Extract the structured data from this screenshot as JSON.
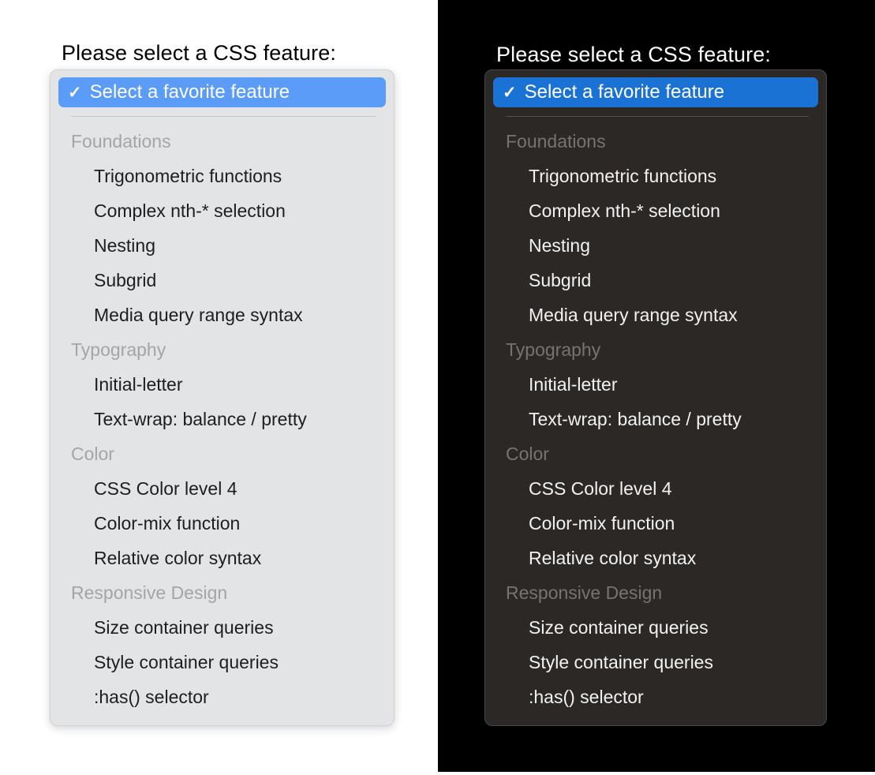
{
  "prompt": {
    "heading": "Please select a CSS feature:"
  },
  "dropdown": {
    "selected_option": {
      "label": "Select a favorite feature",
      "check_icon": "checkmark-icon",
      "check_glyph": "✓"
    },
    "groups": [
      {
        "label": "Foundations",
        "options": [
          "Trigonometric functions",
          "Complex nth-* selection",
          "Nesting",
          "Subgrid",
          "Media query range syntax"
        ]
      },
      {
        "label": "Typography",
        "options": [
          "Initial-letter",
          "Text-wrap: balance / pretty"
        ]
      },
      {
        "label": "Color",
        "options": [
          "CSS Color level 4",
          "Color-mix function",
          "Relative color syntax"
        ]
      },
      {
        "label": "Responsive Design",
        "options": [
          "Size container queries",
          "Style container queries",
          ":has() selector"
        ]
      }
    ]
  },
  "themes": {
    "light": {
      "name": "light",
      "page_background": "#ffffff",
      "panel_background": "#e2e4e6",
      "panel_border": "#d2d4d6",
      "heading_color": "#000000",
      "option_color": "#1e1e1e",
      "group_label_color": "#a3a5a8",
      "highlight_color": "#5a9cf8",
      "separator_color": "#c6c8ca"
    },
    "dark": {
      "name": "dark",
      "page_background": "#000000",
      "panel_background": "#2b2826",
      "panel_border": "#4b4846",
      "heading_color": "#ffffff",
      "option_color": "#f2f2f2",
      "group_label_color": "#78736f",
      "highlight_color": "#1a72d4",
      "separator_color": "#565350"
    }
  }
}
